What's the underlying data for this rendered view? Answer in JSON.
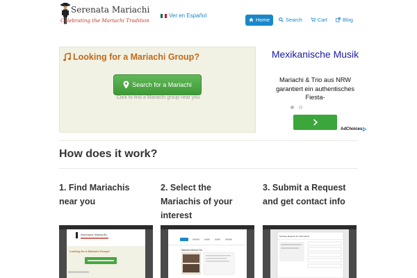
{
  "header": {
    "site_title": "Serenata Mariachi",
    "tagline": "Celebrating the Mariachi Tradition",
    "language_link": "Ver en Español",
    "nav": [
      {
        "label": "Home",
        "icon": "home-icon",
        "active": true
      },
      {
        "label": "Search",
        "icon": "search-icon",
        "active": false
      },
      {
        "label": "Cart",
        "icon": "cart-icon",
        "active": false
      },
      {
        "label": "Blog",
        "icon": "external-link-icon",
        "active": false
      }
    ]
  },
  "hero": {
    "title": "Looking for a Mariachi Group?",
    "button_label": "Search for a Mariachi",
    "hint": "Click to find a Mariachi group near you"
  },
  "ad": {
    "title": "Mexikanische Musik",
    "text": "Mariachi & Trio aus NRW garantiert ein authentisches Fiesta-",
    "adchoices": "AdChoices",
    "slide_count": 2,
    "active_slide": 1
  },
  "how": {
    "heading": "How does it work?",
    "steps": [
      {
        "label": "1. Find Mariachis near you"
      },
      {
        "label": "2. Select the Mariachis of your interest"
      },
      {
        "label": "3. Submit a Request and get contact info"
      }
    ]
  },
  "thumbnails": {
    "t1": {
      "site_title": "Serenata Mariachi",
      "hero_title": "Looking for a Mariachi Group?"
    },
    "t2": {
      "heading": "Mariachi Mexicali Sol"
    },
    "t3": {
      "heading": "Sending Request for Information"
    }
  },
  "colors": {
    "accent_blue": "#1a87c9",
    "button_green": "#3e9a35",
    "hero_title_orange": "#bf6a1a",
    "ad_title_blue": "#1a1aa6",
    "tagline_red": "#c0392b"
  }
}
